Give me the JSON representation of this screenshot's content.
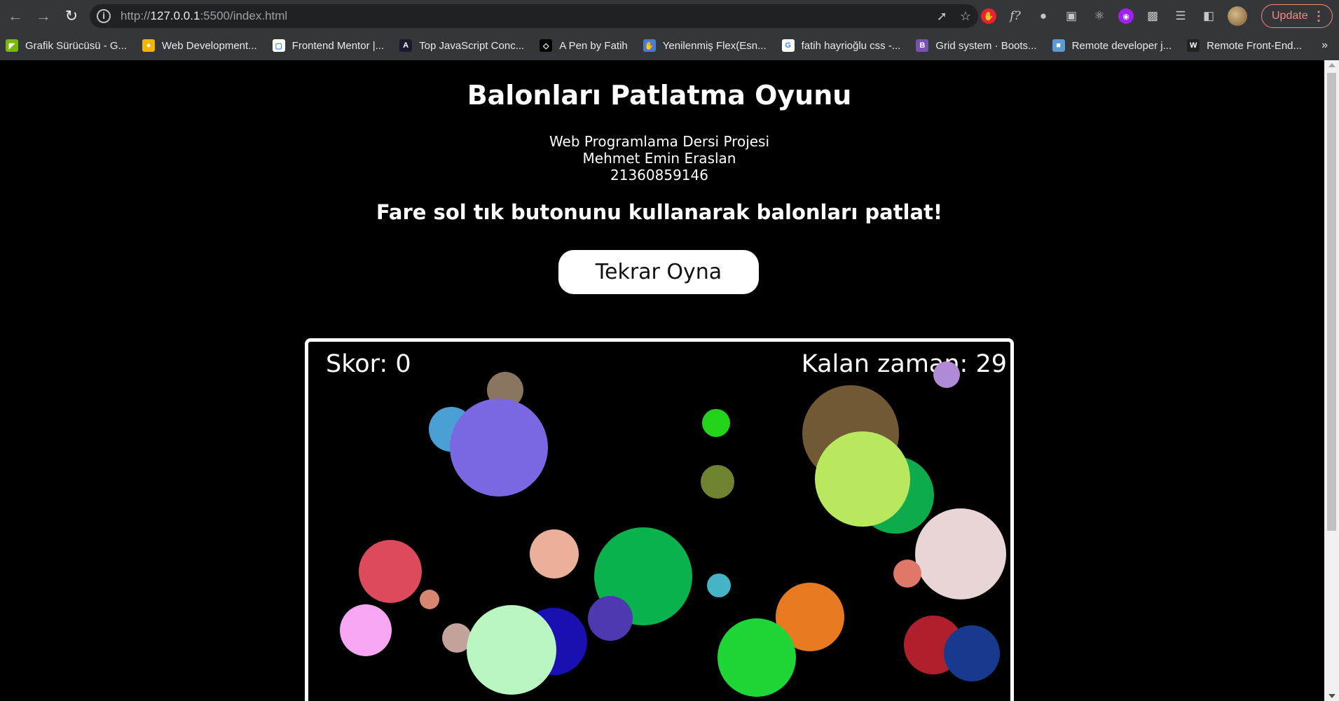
{
  "browser": {
    "url_prefix": "http://",
    "url_host": "127.0.0.1",
    "url_rest": ":5500/index.html",
    "update_label": "Update",
    "bookmarks": [
      {
        "label": "Grafik Sürücüsü - G...",
        "icon": "nvidia-icon",
        "color": "#76b900"
      },
      {
        "label": "Web Development...",
        "icon": "web-dev-icon",
        "color": "#f4b400"
      },
      {
        "label": "Frontend Mentor |...",
        "icon": "frontend-mentor-icon",
        "color": "#ffffff"
      },
      {
        "label": "Top JavaScript Conc...",
        "icon": "angular-icon",
        "color": "#1a1a2e"
      },
      {
        "label": "A Pen by Fatih",
        "icon": "codepen-icon",
        "color": "#000000"
      },
      {
        "label": "Yenilenmiş Flex(Esn...",
        "icon": "hand-icon",
        "color": "#4a7bd1"
      },
      {
        "label": "fatih hayrioğlu css -...",
        "icon": "google-icon",
        "color": "#ffffff"
      },
      {
        "label": "Grid system · Boots...",
        "icon": "bootstrap-icon",
        "color": "#7952b3"
      },
      {
        "label": "Remote developer j...",
        "icon": "remote-icon",
        "color": "#5a9bd5"
      },
      {
        "label": "Remote Front-End...",
        "icon": "wwr-icon",
        "color": "#222222"
      }
    ]
  },
  "page": {
    "title": "Balonları Patlatma Oyunu",
    "course": "Web Programlama Dersi Projesi",
    "author": "Mehmet Emin Eraslan",
    "student_id": "21360859146",
    "instruction": "Fare sol tık butonunu kullanarak balonları patlat!",
    "replay_label": "Tekrar Oyna"
  },
  "game": {
    "score_label": "Skor: 0",
    "timer_label": "Kalan zaman: 29",
    "balloons": [
      {
        "color": "#b18ad6"
      },
      {
        "color": "#8a7560"
      },
      {
        "color": "#4a9fd4"
      },
      {
        "color": "#7a68e2"
      },
      {
        "color": "#22d31a"
      },
      {
        "color": "#725936"
      },
      {
        "color": "#0dab4c"
      },
      {
        "color": "#b7e85e"
      },
      {
        "color": "#6e8230"
      },
      {
        "color": "#e8d5d5"
      },
      {
        "color": "#eab09c"
      },
      {
        "color": "#dc4a5b"
      },
      {
        "color": "#e0786a"
      },
      {
        "color": "#0ab24e"
      },
      {
        "color": "#d78671"
      },
      {
        "color": "#45b4c7"
      },
      {
        "color": "#5038b0"
      },
      {
        "color": "#e77a20"
      },
      {
        "color": "#f6a6f2"
      },
      {
        "color": "#c2a39c"
      },
      {
        "color": "#1a0fb0"
      },
      {
        "color": "#b9f6c1"
      },
      {
        "color": "#1ed636"
      },
      {
        "color": "#b01f2c"
      },
      {
        "color": "#173a8f"
      }
    ]
  }
}
